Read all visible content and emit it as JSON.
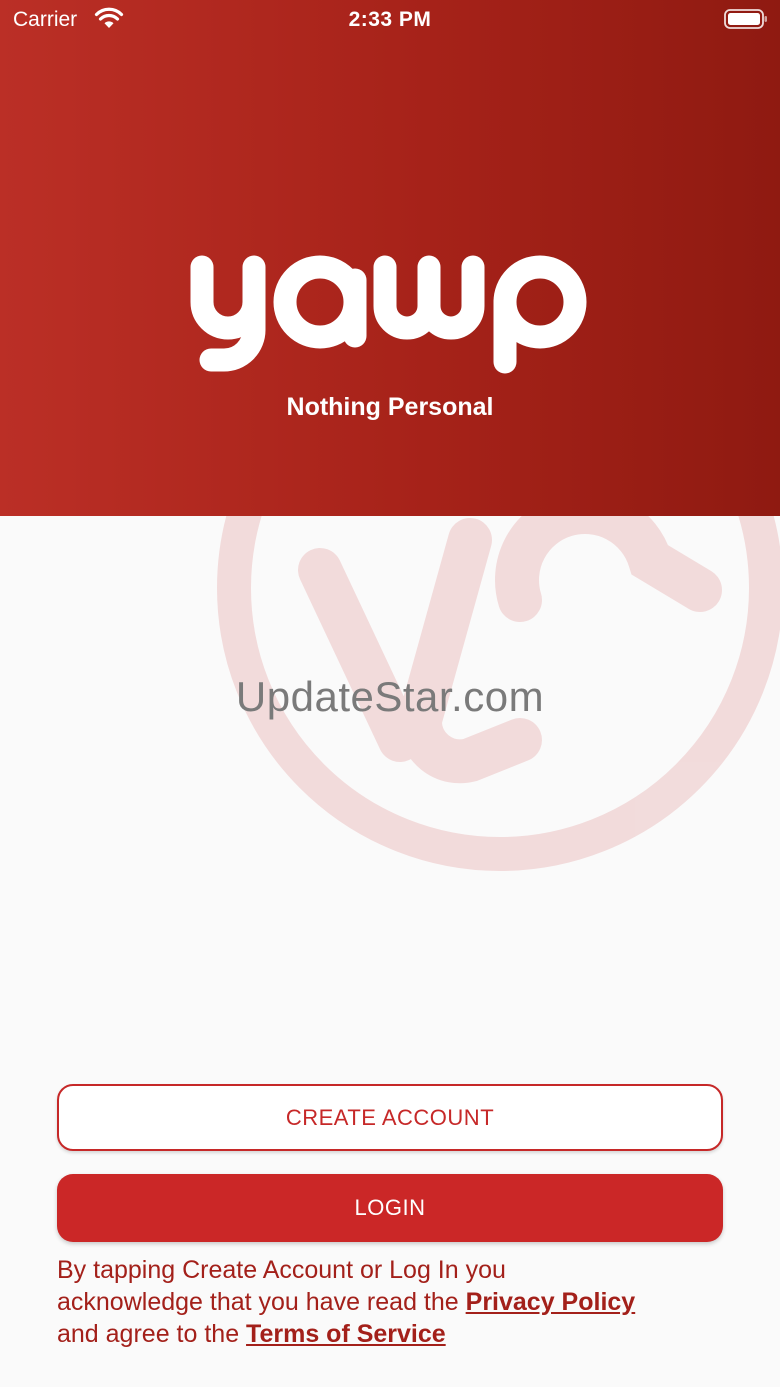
{
  "status_bar": {
    "carrier": "Carrier",
    "time": "2:33 PM",
    "wifi_icon": "wifi-icon",
    "battery_icon": "battery-icon"
  },
  "header": {
    "logo_text": "yawp",
    "tagline": "Nothing Personal"
  },
  "watermark": {
    "text": "UpdateStar.com",
    "logo_text": "ya"
  },
  "actions": {
    "create_account_label": "CREATE ACCOUNT",
    "login_label": "LOGIN"
  },
  "legal": {
    "line1": "By tapping Create Account or Log In you",
    "line2": "acknowledge that you have read the",
    "privacy_link": "Privacy Policy",
    "line3": "and agree to the",
    "terms_link": "Terms of Service"
  },
  "colors": {
    "brand_red": "#c62828",
    "header_gradient_start": "#bb2f26",
    "header_gradient_end": "#8f1a11",
    "link_color": "#a3201a",
    "background": "#fafafa"
  }
}
